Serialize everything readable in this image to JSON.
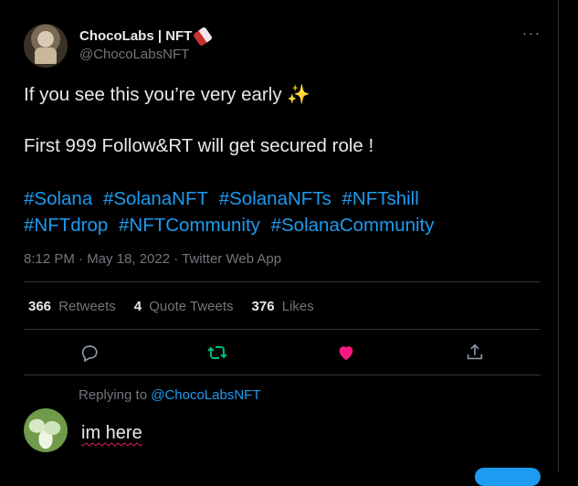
{
  "author": {
    "display_name": "ChocoLabs | NFT",
    "handle": "@ChocoLabsNFT"
  },
  "tweet": {
    "line1": "If you see this you’re very early ✨",
    "line2": "First 999 Follow&RT will get secured role !",
    "hashtags": [
      "#Solana",
      "#SolanaNFT",
      "#SolanaNFTs",
      "#NFTshill",
      "#NFTdrop",
      "#NFTCommunity",
      "#SolanaCommunity"
    ],
    "meta": "8:12 PM · May 18, 2022 · Twitter Web App"
  },
  "stats": {
    "retweets_count": "366",
    "retweets_label": "Retweets",
    "quotes_count": "4",
    "quotes_label": "Quote Tweets",
    "likes_count": "376",
    "likes_label": "Likes"
  },
  "actions": {
    "reply_icon": "reply-icon",
    "retweet_icon": "retweet-icon",
    "like_icon": "heart-icon",
    "share_icon": "share-icon",
    "retweet_color": "#00ba7c",
    "like_color": "#f91880"
  },
  "reply": {
    "replying_prefix": "Replying to",
    "replying_to": "@ChocoLabsNFT",
    "input_value": "im here"
  },
  "colors": {
    "accent": "#1d9bf0",
    "background": "#000000",
    "muted": "#71767b"
  }
}
